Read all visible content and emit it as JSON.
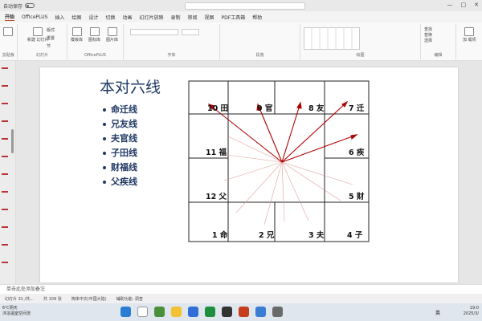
{
  "titlebar": {
    "autosave": "自动保存",
    "doc_title": "",
    "window_controls": [
      "—",
      "□",
      "✕"
    ]
  },
  "menu": [
    "开始",
    "OfficePLUS",
    "插入",
    "绘图",
    "设计",
    "切换",
    "动画",
    "幻灯片放映",
    "录制",
    "审阅",
    "视图",
    "PDF工具箱",
    "帮助"
  ],
  "ribbon": {
    "new_slide": "新建\n幻灯片",
    "layout": "版式",
    "reset": "重置",
    "section": "节",
    "slide_group": "幻灯片",
    "templates": "模板库",
    "icons_lib": "图标库",
    "images_lib": "图片库",
    "officeplus_group": "OfficePLUS",
    "font_group": "字体",
    "paragraph_group": "段落",
    "drawing_group": "绘图",
    "editing_group": "编辑",
    "find": "查找",
    "replace": "替换",
    "select": "选择",
    "addins": "加\n载项",
    "clipboard_group": "剪贴板"
  },
  "slide": {
    "title": "本对六线",
    "bullets": [
      "命迁线",
      "兄友线",
      "夫官线",
      "子田线",
      "财福线",
      "父疾线"
    ],
    "cells": {
      "top": [
        "10 田",
        "9 官",
        "8 友",
        "7 迁"
      ],
      "left_mid": [
        "11 福",
        "12 父"
      ],
      "right_mid": [
        "6 疾",
        "5 财"
      ],
      "bottom": [
        "1 命",
        "2 兄",
        "3 夫",
        "4 子"
      ]
    }
  },
  "notes": "单击此处添加备注",
  "status": {
    "slide_num": "幻灯片 31 /共...",
    "words": "共 109 张",
    "language": "简体中文(中国大陆)",
    "accessibility": "辅助功能: 调查"
  },
  "taskbar": {
    "weather_temp": "6℃阴天",
    "weather_desc": "沐浴温室空间流",
    "ime": "英",
    "time": "19:0",
    "date": "2025/3/"
  }
}
